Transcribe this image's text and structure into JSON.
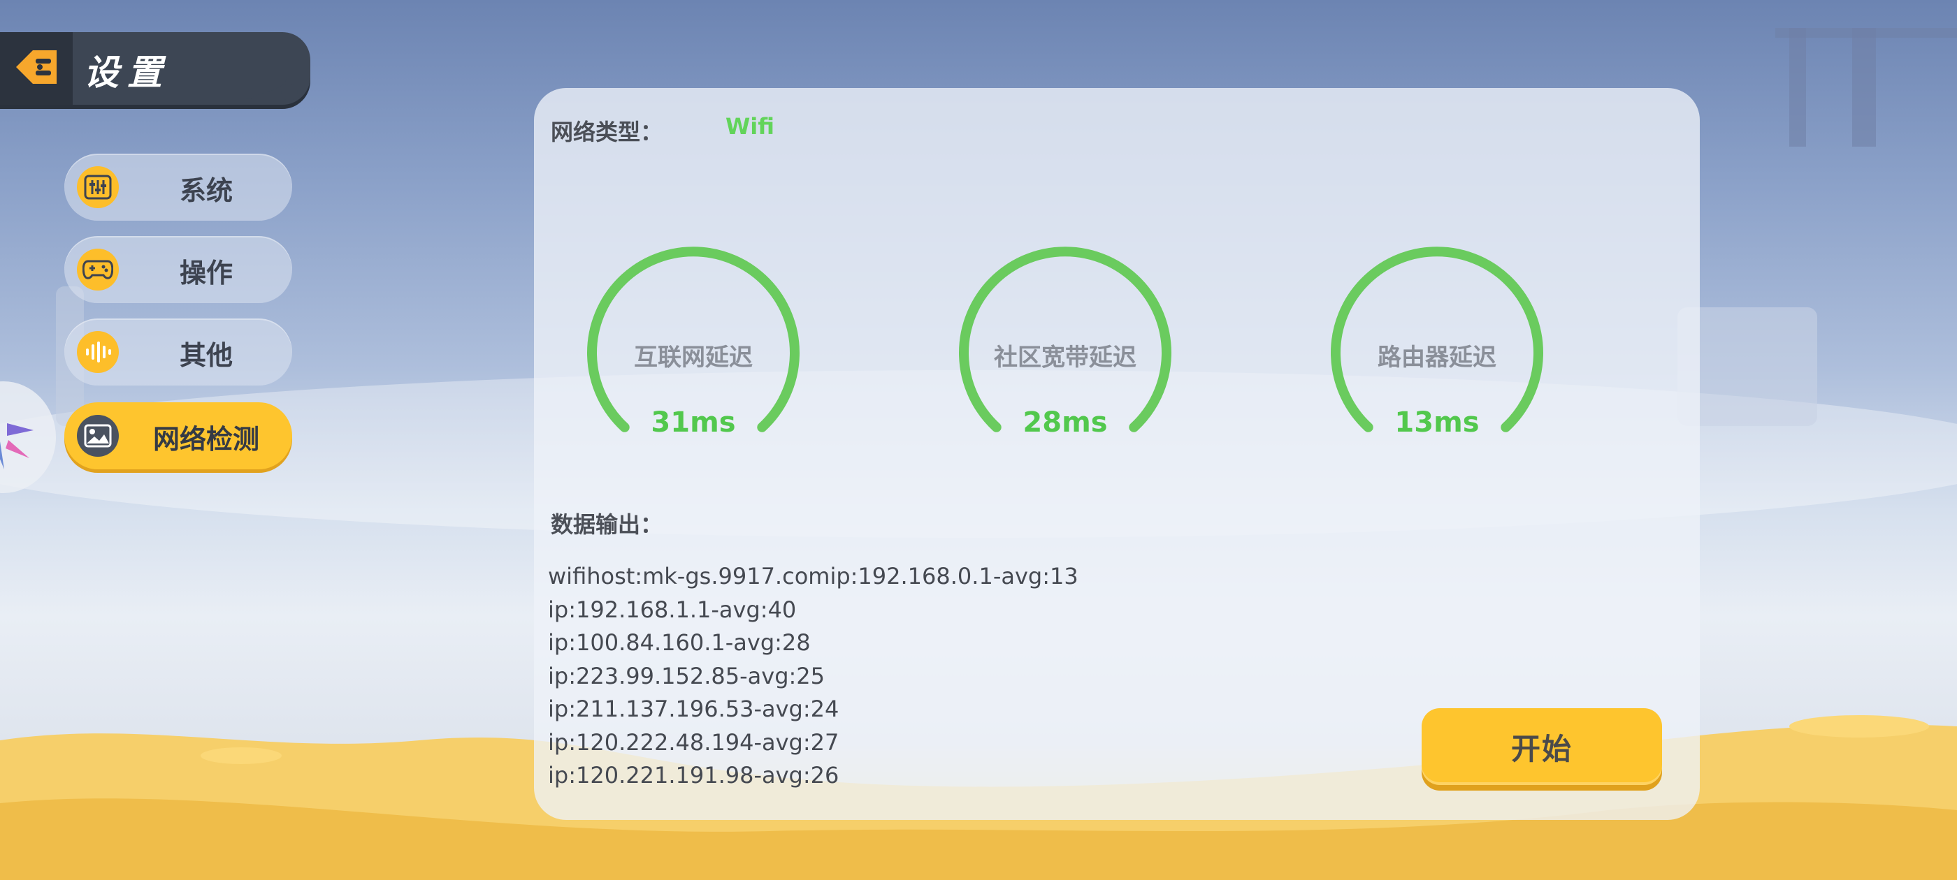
{
  "header": {
    "title": "设置",
    "back_icon": "back-arrow-icon"
  },
  "sidebar": {
    "items": [
      {
        "label": "系统",
        "icon": "sliders-icon",
        "active": false
      },
      {
        "label": "操作",
        "icon": "gamepad-icon",
        "active": false
      },
      {
        "label": "其他",
        "icon": "sound-wave-icon",
        "active": false
      },
      {
        "label": "网络检测",
        "icon": "image-icon",
        "active": true
      }
    ]
  },
  "network": {
    "type_label": "网络类型：",
    "type_value": "Wifi",
    "gauges": [
      {
        "label": "互联网延迟",
        "value": "31ms"
      },
      {
        "label": "社区宽带延迟",
        "value": "28ms"
      },
      {
        "label": "路由器延迟",
        "value": "13ms"
      }
    ],
    "output_label": "数据输出：",
    "output_lines": [
      "wifihost:mk-gs.9917.comip:192.168.0.1-avg:13",
      "ip:192.168.1.1-avg:40",
      "ip:100.84.160.1-avg:28",
      "ip:223.99.152.85-avg:25",
      "ip:211.137.196.53-avg:24",
      "ip:120.222.48.194-avg:27",
      "ip:120.221.191.98-avg:26"
    ],
    "start_label": "开始"
  },
  "colors": {
    "accent": "#fec52e",
    "gauge": "#6acb5e",
    "text_green": "#52c84d",
    "header_bg": "#3d4654"
  }
}
